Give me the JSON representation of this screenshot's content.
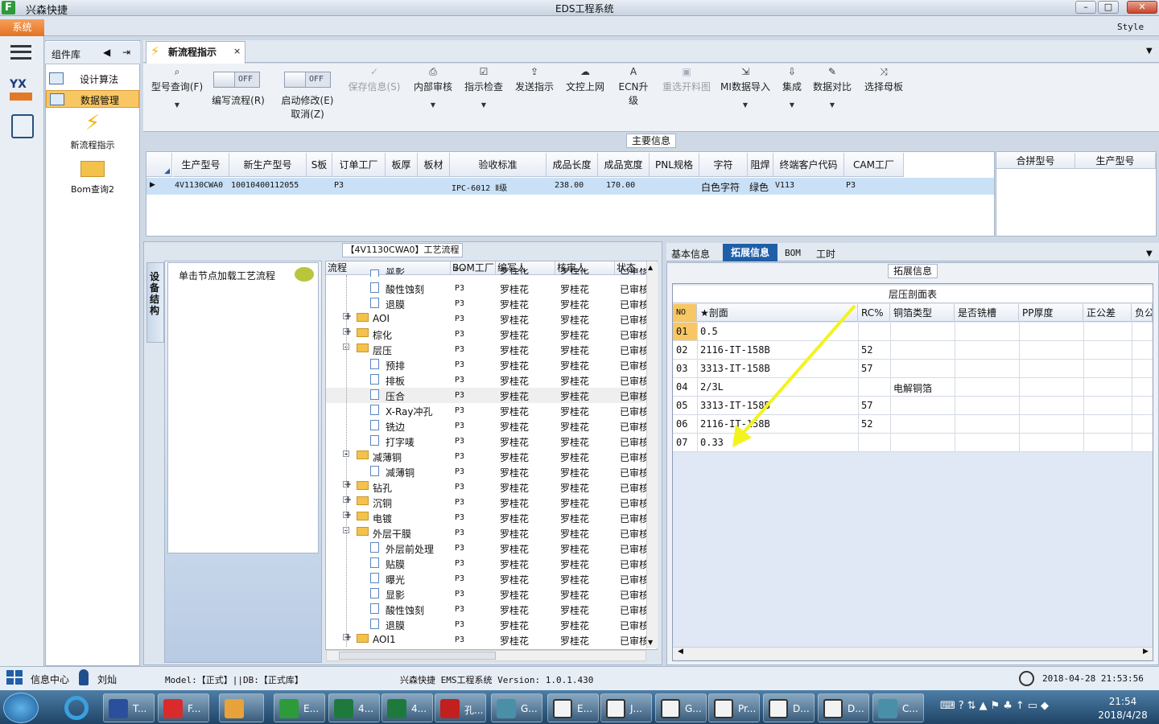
{
  "app": {
    "name": "兴森快捷",
    "window_title": "EDS工程系统",
    "menu_system": "系统",
    "style_label": "Style"
  },
  "window_controls": {
    "minimize": "–",
    "maximize": "□",
    "close": "✕"
  },
  "component_panel": {
    "title": "组件库",
    "items": [
      {
        "label": "设计算法"
      },
      {
        "label": "数据管理"
      }
    ],
    "big_items": [
      {
        "label": "新流程指示"
      },
      {
        "label": "Bom查询2"
      }
    ]
  },
  "tab": {
    "label": "新流程指示",
    "close": "×"
  },
  "ribbon": {
    "buttons": [
      {
        "label": "型号查询(F)",
        "icon": "search-icon",
        "enabled": true,
        "dropdown": true
      },
      {
        "label": "保存信息(S)",
        "icon": "check-icon",
        "enabled": false
      },
      {
        "label": "内部审核",
        "icon": "print-icon",
        "enabled": true,
        "dropdown": true
      },
      {
        "label": "指示检查",
        "icon": "checkbox-icon",
        "enabled": true,
        "dropdown": true
      },
      {
        "label": "发送指示",
        "icon": "upload-icon",
        "enabled": true
      },
      {
        "label": "文控上网",
        "icon": "cloud-icon",
        "enabled": true
      },
      {
        "label": "ECN升级",
        "icon": "ecn-icon",
        "enabled": true
      },
      {
        "label": "重选开料图",
        "icon": "image-icon",
        "enabled": false
      },
      {
        "label": "MI数据导入",
        "icon": "import-icon",
        "enabled": true,
        "dropdown": true
      },
      {
        "label": "集成",
        "icon": "download-icon",
        "enabled": true,
        "dropdown": true
      },
      {
        "label": "数据对比",
        "icon": "compare-icon",
        "enabled": true,
        "dropdown": true
      },
      {
        "label": "选择母板",
        "icon": "shuffle-icon",
        "enabled": true
      }
    ],
    "toggles": [
      {
        "state": "OFF",
        "label": "编写流程(R)"
      },
      {
        "state": "OFF",
        "label": "启动修改(E)",
        "label2": "取消(Z)"
      }
    ]
  },
  "main_info": {
    "caption": "主要信息",
    "columns": [
      "生产型号",
      "新生产型号",
      "S板",
      "订单工厂",
      "板厚",
      "板材",
      "验收标准",
      "成品长度",
      "成品宽度",
      "PNL规格",
      "字符",
      "阻焊",
      "终端客户代码",
      "CAM工厂"
    ],
    "row": [
      "4V1130CWA0",
      "10010400112055",
      "",
      "P3",
      "",
      "",
      "IPC-6012 Ⅱ级",
      "238.00",
      "170.00",
      "",
      "白色字符",
      "绿色",
      "V113",
      "P3"
    ],
    "side_columns": [
      "合拼型号",
      "生产型号"
    ]
  },
  "process": {
    "caption": "【4V1130CWA0】工艺流程",
    "side_tab": "设备结构",
    "hint": "单击节点加载工艺流程",
    "columns": [
      "流程",
      "BOM工厂",
      "编写人",
      "核审人",
      "状态"
    ],
    "rows": [
      {
        "name": "显影",
        "level": 2,
        "type": "doc",
        "partial": true
      },
      {
        "name": "酸性蚀刻",
        "level": 2,
        "type": "doc"
      },
      {
        "name": "退膜",
        "level": 2,
        "type": "doc"
      },
      {
        "name": "AOI",
        "level": 1,
        "type": "folder",
        "expand": "+"
      },
      {
        "name": "棕化",
        "level": 1,
        "type": "folder",
        "expand": "+"
      },
      {
        "name": "层压",
        "level": 1,
        "type": "folder",
        "expand": "-"
      },
      {
        "name": "预排",
        "level": 2,
        "type": "doc"
      },
      {
        "name": "排板",
        "level": 2,
        "type": "doc"
      },
      {
        "name": "压合",
        "level": 2,
        "type": "doc",
        "selected": true
      },
      {
        "name": "X-Ray冲孔",
        "level": 2,
        "type": "doc"
      },
      {
        "name": "铣边",
        "level": 2,
        "type": "doc"
      },
      {
        "name": "打字唛",
        "level": 2,
        "type": "doc"
      },
      {
        "name": "减薄铜",
        "level": 1,
        "type": "folder",
        "expand": "-"
      },
      {
        "name": "减薄铜",
        "level": 2,
        "type": "doc"
      },
      {
        "name": "钻孔",
        "level": 1,
        "type": "folder",
        "expand": "+"
      },
      {
        "name": "沉铜",
        "level": 1,
        "type": "folder",
        "expand": "+"
      },
      {
        "name": "电镀",
        "level": 1,
        "type": "folder",
        "expand": "+"
      },
      {
        "name": "外层干膜",
        "level": 1,
        "type": "folder",
        "expand": "-"
      },
      {
        "name": "外层前处理",
        "level": 2,
        "type": "doc"
      },
      {
        "name": "贴膜",
        "level": 2,
        "type": "doc"
      },
      {
        "name": "曝光",
        "level": 2,
        "type": "doc"
      },
      {
        "name": "显影",
        "level": 2,
        "type": "doc"
      },
      {
        "name": "酸性蚀刻",
        "level": 2,
        "type": "doc"
      },
      {
        "name": "退膜",
        "level": 2,
        "type": "doc"
      },
      {
        "name": "AOI1",
        "level": 1,
        "type": "folder",
        "expand": "+"
      }
    ],
    "bom": "P3",
    "writer": "罗桂花",
    "reviewer": "罗桂花",
    "status": "已审核"
  },
  "ext": {
    "tabs": [
      "基本信息",
      "拓展信息",
      "BOM",
      "工时"
    ],
    "active_tab": 1,
    "caption": "拓展信息",
    "table_title": "层压剖面表",
    "columns": [
      "NO",
      "★剖面",
      "RC%",
      "铜箔类型",
      "是否铣槽",
      "PP厚度",
      "正公差",
      "负公"
    ],
    "rows": [
      [
        "01",
        "0.5",
        "",
        ""
      ],
      [
        "02",
        "2116-IT-158B",
        "52",
        ""
      ],
      [
        "03",
        "3313-IT-158B",
        "57",
        ""
      ],
      [
        "04",
        "2/3L",
        "",
        "电解铜箔"
      ],
      [
        "05",
        "3313-IT-158B",
        "57",
        ""
      ],
      [
        "06",
        "2116-IT-158B",
        "52",
        ""
      ],
      [
        "07",
        "0.33",
        "",
        ""
      ]
    ],
    "annotation_color": "#f3f31e"
  },
  "status": {
    "info_center": "信息中心",
    "user": "刘灿",
    "model": "Model:【正式】||DB:【正式库】",
    "version": "兴森快捷 EMS工程系统 Version: 1.0.1.430",
    "datetime": "2018-04-28 21:53:56"
  },
  "taskbar": {
    "items": [
      {
        "label": "T...",
        "color": "#2b4f9c"
      },
      {
        "label": "F...",
        "color": "#d92b2b"
      },
      {
        "label": "",
        "color": "#e8a23a"
      },
      {
        "label": "E...",
        "color": "#2e9b3a"
      },
      {
        "label": "4...",
        "color": "#1e7a3c"
      },
      {
        "label": "4...",
        "color": "#1e7a3c"
      },
      {
        "label": "孔...",
        "color": "#c21f1f"
      },
      {
        "label": "G...",
        "color": "#4a8fa8"
      },
      {
        "label": "E...",
        "color": "#f3f3f3"
      },
      {
        "label": "J...",
        "color": "#f3f3f3"
      },
      {
        "label": "G...",
        "color": "#f3f3f3"
      },
      {
        "label": "Pr...",
        "color": "#f3f3f3"
      },
      {
        "label": "D...",
        "color": "#f3f3f3"
      },
      {
        "label": "D...",
        "color": "#f3f3f3"
      },
      {
        "label": "C...",
        "color": "#4a8fa8"
      }
    ],
    "time": "21:54",
    "date": "2018/4/28"
  }
}
